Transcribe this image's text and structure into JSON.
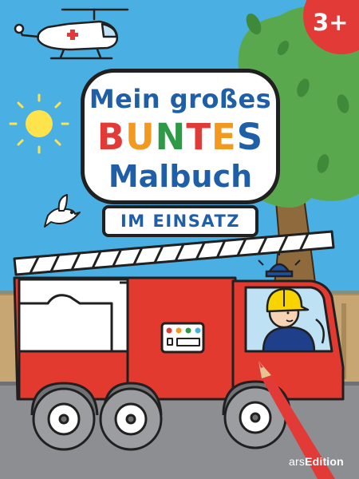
{
  "title": {
    "line1": "Mein großes",
    "line2_letters": [
      {
        "char": "B",
        "color": "#e23b37"
      },
      {
        "char": "U",
        "color": "#f29a1f"
      },
      {
        "char": "N",
        "color": "#2e9a45"
      },
      {
        "char": "T",
        "color": "#e23b37"
      },
      {
        "char": "E",
        "color": "#f29a1f"
      },
      {
        "char": "S",
        "color": "#1f5fa8"
      }
    ],
    "line2": "BUNTES",
    "line3": "Malbuch"
  },
  "subtitle": "IM EINSATZ",
  "age_badge": "3+",
  "publisher": {
    "prefix": "ars",
    "name": "Edition"
  },
  "colors": {
    "sky": "#4ab0e4",
    "title_blue": "#1f5fa8",
    "badge_red": "#e23b37",
    "tree_green": "#5aa84e",
    "wall_tan": "#c7a673",
    "street_gray": "#8c8e92",
    "truck_red": "#e33a2f"
  },
  "icons": [
    "helicopter-icon",
    "sun-icon",
    "bird-icon",
    "tree-icon",
    "fire-truck-icon",
    "firefighter-icon",
    "siren-icon",
    "colored-pencil-icon"
  ]
}
